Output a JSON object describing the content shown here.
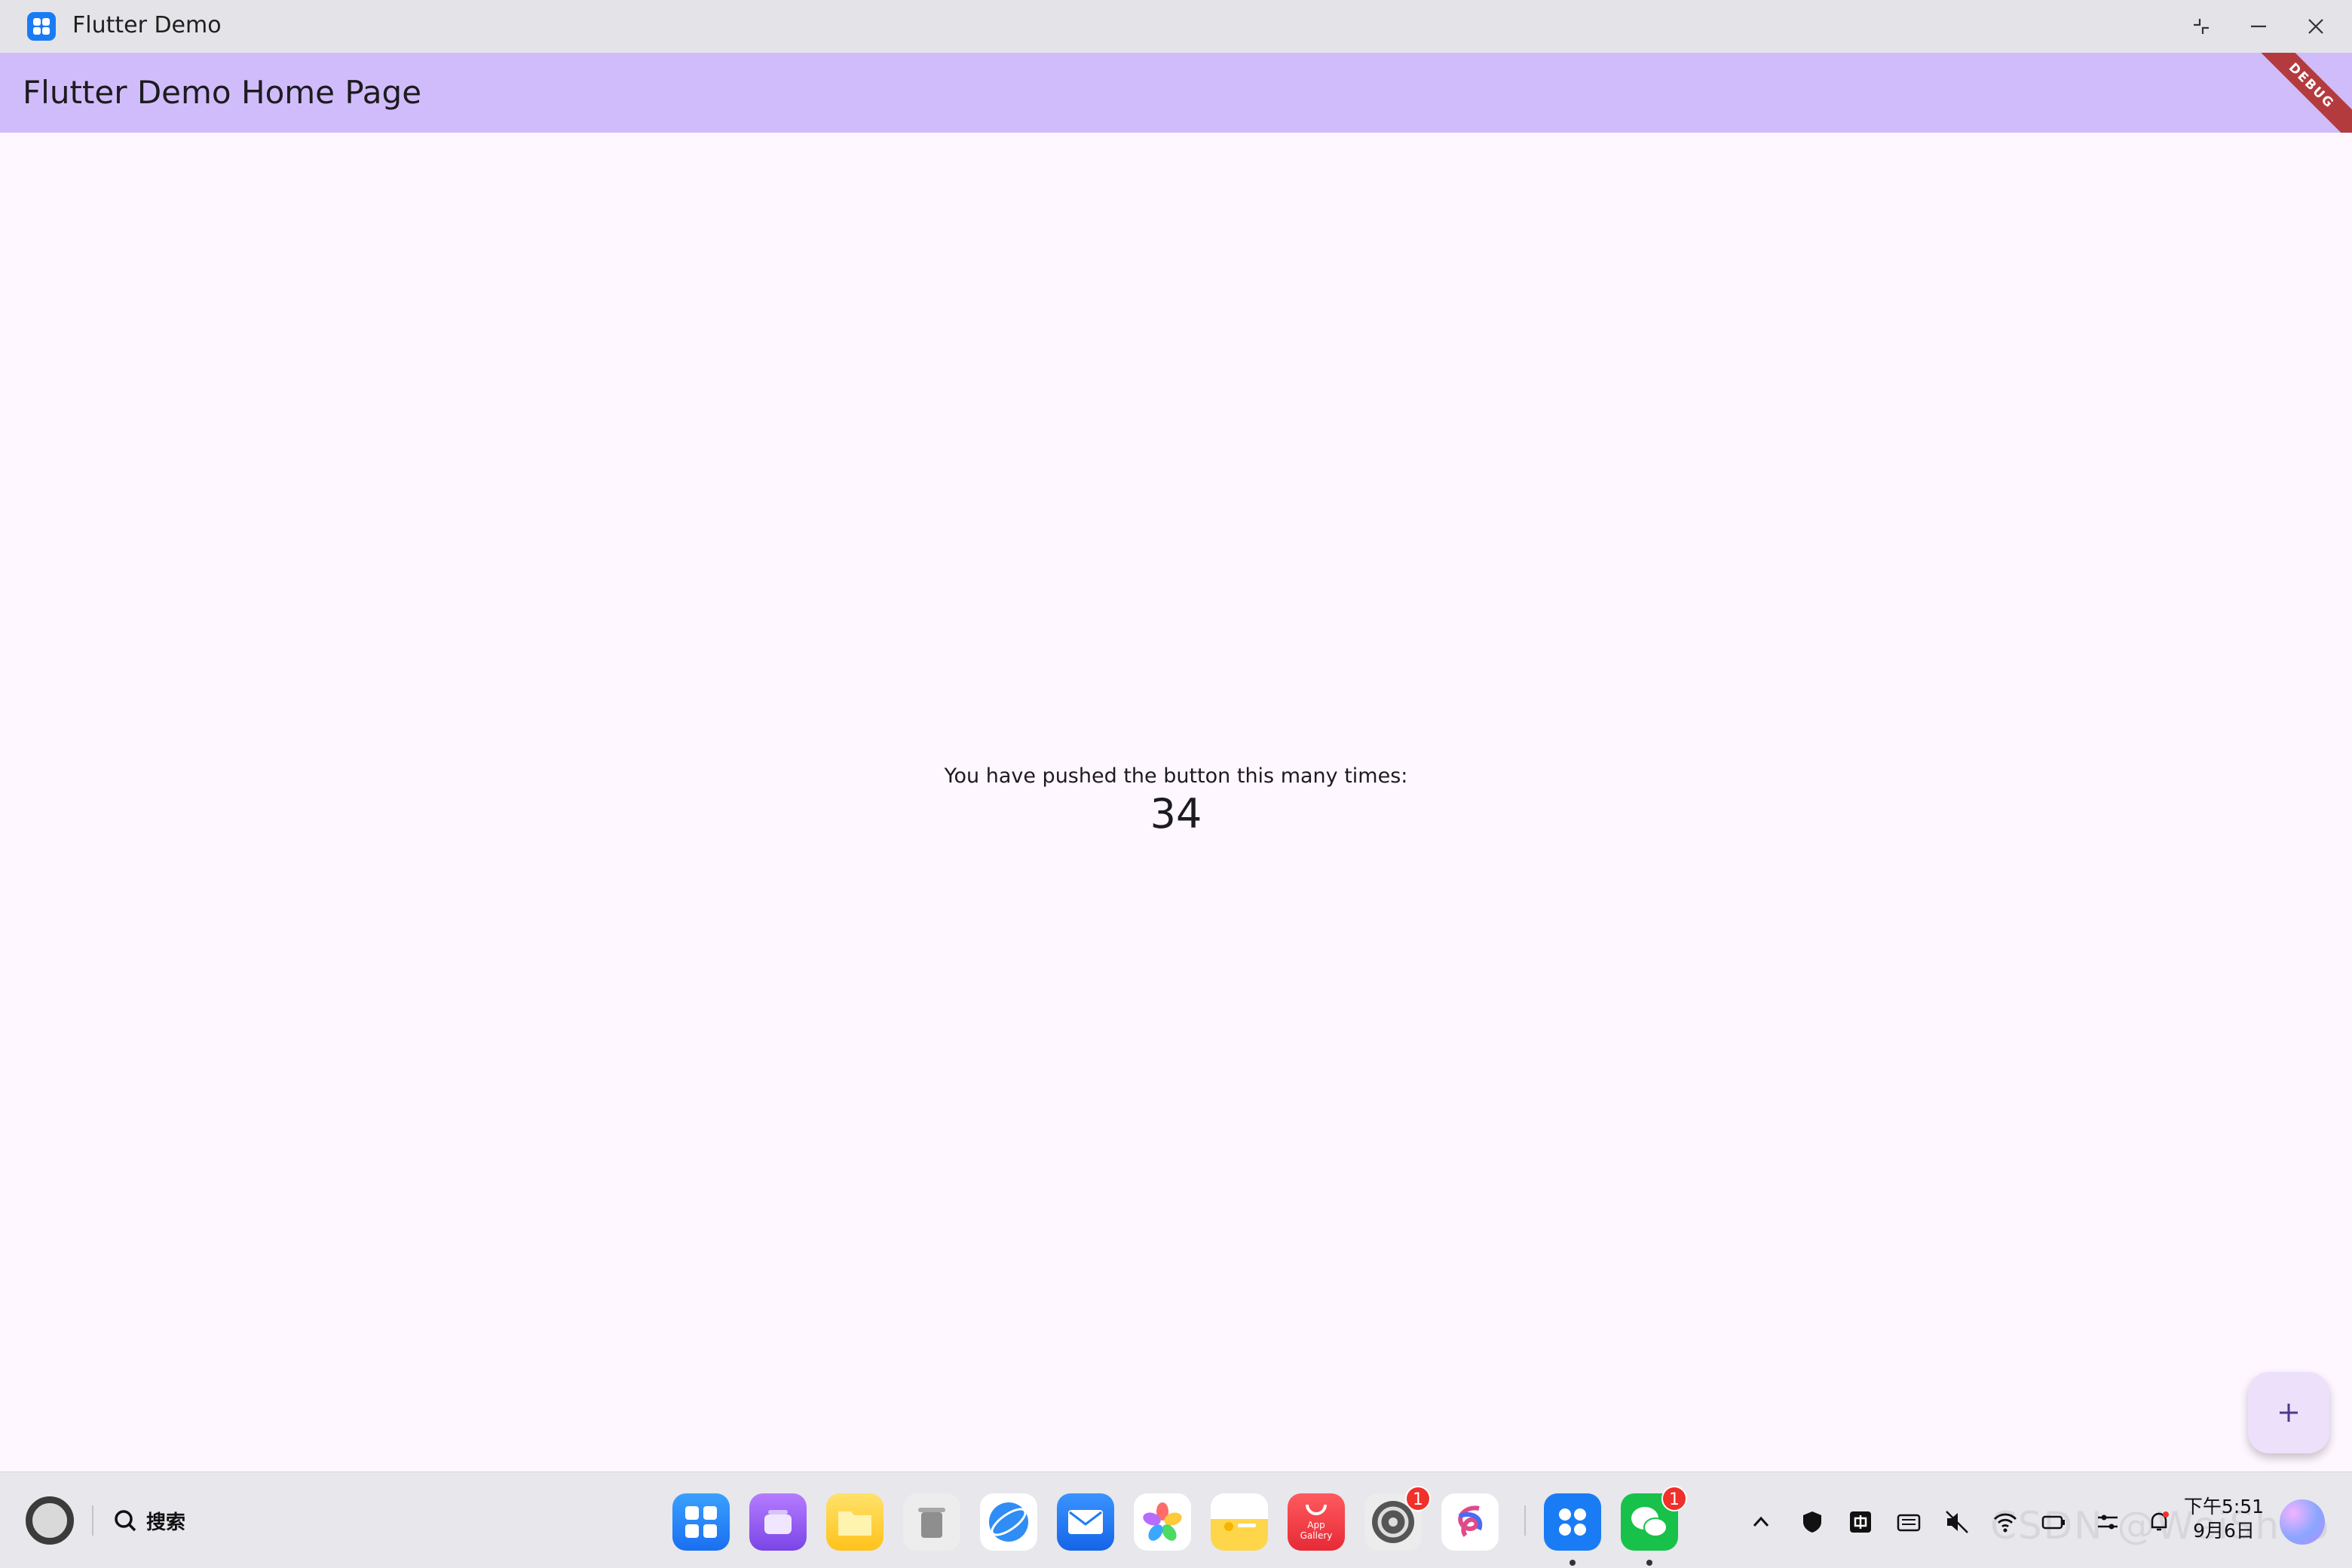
{
  "window": {
    "title": "Flutter Demo"
  },
  "appbar": {
    "title": "Flutter Demo Home Page",
    "debug_banner": "DEBUG",
    "color": "#d1bcfb"
  },
  "body": {
    "counter_label": "You have pushed the button this many times:",
    "counter_value": "34",
    "background": "#fef7ff"
  },
  "fab": {
    "icon": "plus-icon"
  },
  "taskbar": {
    "search_label": "搜索",
    "dock": [
      {
        "name": "app-center-icon",
        "color": "#2a8cf7"
      },
      {
        "name": "multi-window-icon",
        "color": "#8a5cf0"
      },
      {
        "name": "files-icon",
        "color": "#ffc928"
      },
      {
        "name": "trash-icon",
        "color": "#9b9b9b"
      },
      {
        "name": "browser-icon",
        "color": "#2a8df5"
      },
      {
        "name": "mail-icon",
        "color": "#1e7cf5"
      },
      {
        "name": "gallery-icon",
        "color": "#ffffff"
      },
      {
        "name": "notes-icon",
        "color": "#ffd54a"
      },
      {
        "name": "app-gallery-icon",
        "color": "#f0313c",
        "label": "App\nGallery"
      },
      {
        "name": "settings-icon",
        "color": "#4a4a4a",
        "badge": "1"
      },
      {
        "name": "assistant-app-icon",
        "color": "#ffffff"
      },
      {
        "name": "flutter-demo-icon",
        "color": "#1a7cf5"
      },
      {
        "name": "wechat-icon",
        "color": "#18c14a",
        "badge": "1"
      }
    ],
    "tray": [
      "chevron-up-icon",
      "shield-icon",
      "ime-icon",
      "keyboard-icon",
      "volume-muted-icon",
      "wifi-icon",
      "battery-icon",
      "controls-icon",
      "notification-icon"
    ],
    "clock": {
      "time": "下午5:51",
      "date": "9月6日"
    },
    "watermark": "CSDN @WeiShuo"
  }
}
